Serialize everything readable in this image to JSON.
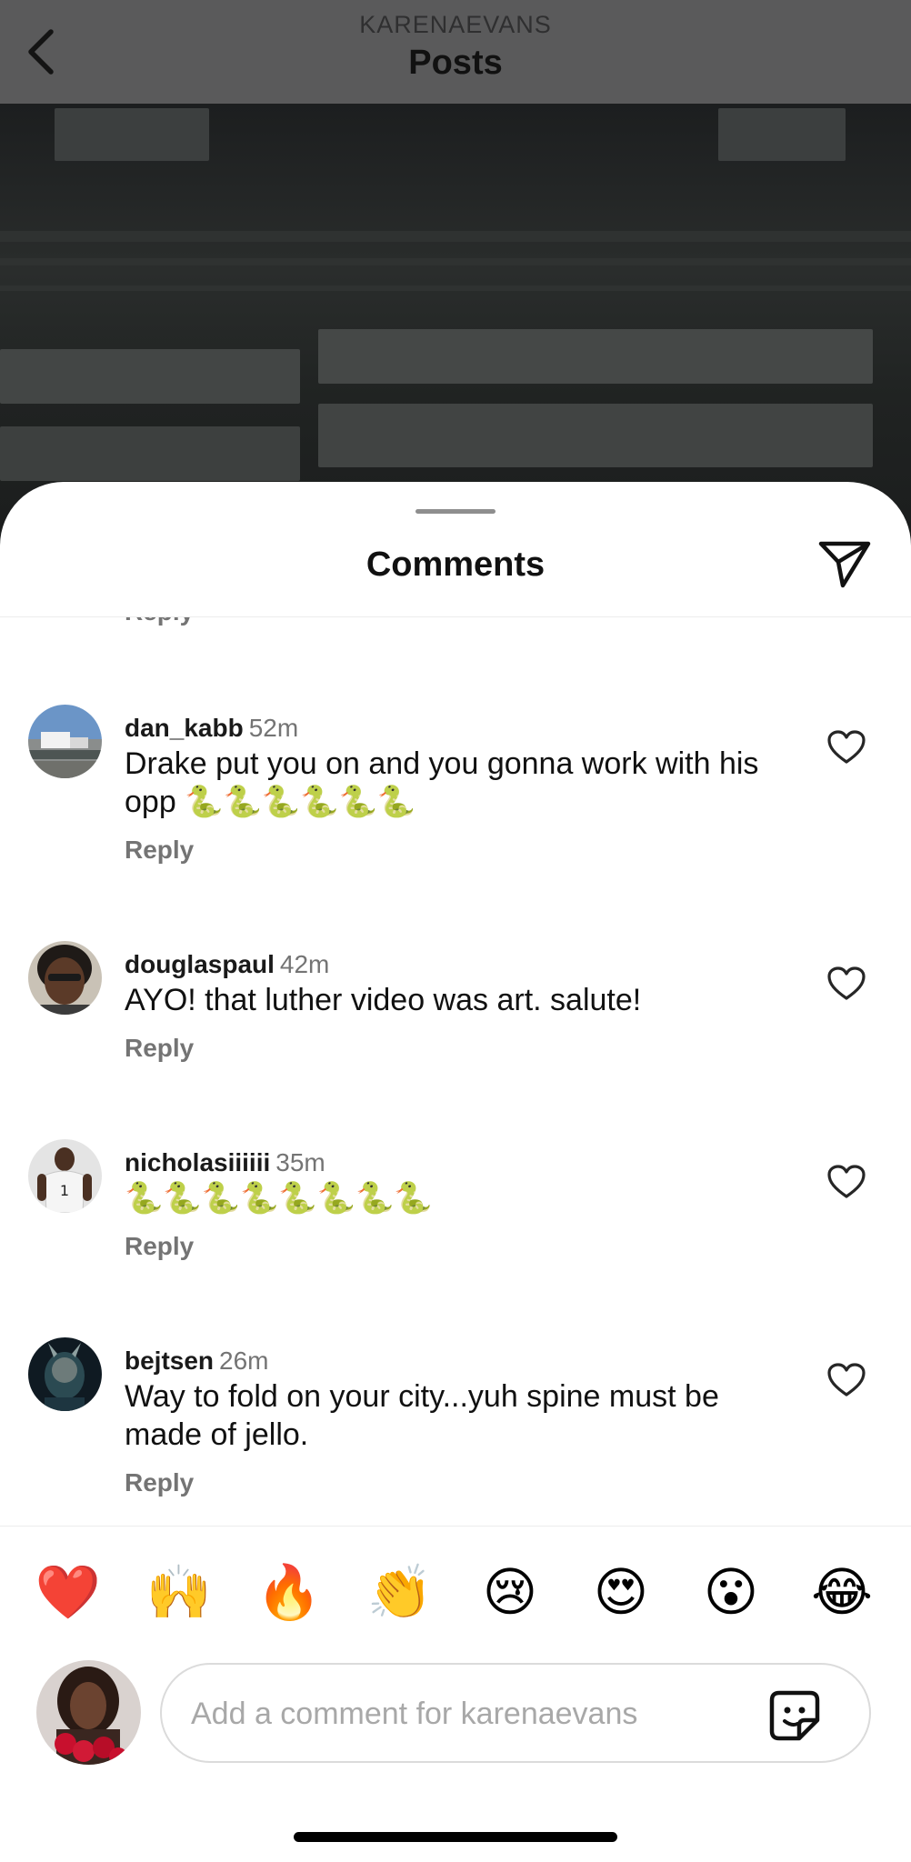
{
  "header": {
    "subtitle": "KARENAEVANS",
    "title": "Posts"
  },
  "sheet": {
    "title": "Comments",
    "partial_reply": "Reply"
  },
  "comments": [
    {
      "username": "dan_kabb",
      "time": "52m",
      "text": "Drake put you on and you gonna work with his opp 🐍🐍🐍🐍🐍🐍",
      "reply": "Reply"
    },
    {
      "username": "douglaspaul",
      "time": "42m",
      "text": "AYO! that luther video was art. salute!",
      "reply": "Reply"
    },
    {
      "username": "nicholasiiiiii",
      "time": "35m",
      "text": "🐍🐍🐍🐍🐍🐍🐍🐍",
      "reply": "Reply"
    },
    {
      "username": "bejtsen",
      "time": "26m",
      "text": "Way to fold on your city...yuh spine must be made of jello.",
      "reply": "Reply"
    }
  ],
  "quick_reactions": [
    "❤️",
    "🙌",
    "🔥",
    "👏",
    "😢",
    "😍",
    "😮",
    "😂"
  ],
  "composer": {
    "placeholder": "Add a comment for karenaevans"
  },
  "icons": {
    "back": "chevron-left-icon",
    "share": "paper-plane-icon",
    "like": "heart-outline-icon",
    "sticker": "sticker-icon"
  }
}
